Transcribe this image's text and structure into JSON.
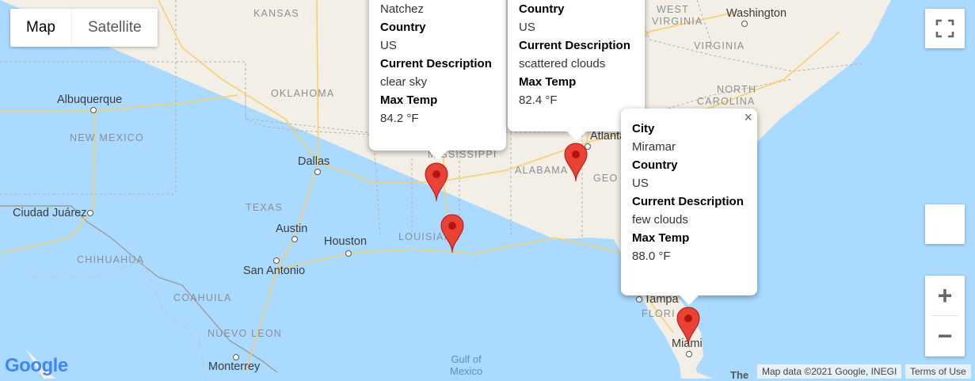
{
  "map": {
    "type_control": {
      "map_label": "Map",
      "satellite_label": "Satellite"
    },
    "state_labels": [
      "KANSAS",
      "OKLAHOMA",
      "NEW MEXICO",
      "TEXAS",
      "LOUISIANA",
      "MISSISSIPPI",
      "ALABAMA",
      "GEO",
      "WEST",
      "VIRGINIA",
      "VIRGINIA",
      "NORTH",
      "CAROLINA",
      "FLORI",
      "CHIHUAHUA",
      "COAHUILA",
      "NUEVO LEON"
    ],
    "city_labels": [
      "Albuquerque",
      "Dallas",
      "Ciudad Juárez",
      "Austin",
      "Houston",
      "San Antonio",
      "Monterrey",
      "Atlanta",
      "Washington",
      "Tampa",
      "Miami",
      "Natchez"
    ],
    "water_label_line1": "Gulf of",
    "water_label_line2": "Mexico",
    "partial_label": "The",
    "google_logo": "Google",
    "attribution": "Map data ©2021 Google, INEGI",
    "terms": "Terms of Use",
    "zoom_in": "+",
    "zoom_out": "−",
    "marker_color": "#ea4335"
  },
  "info_windows": [
    {
      "rows": [
        {
          "k": "",
          "v": "Natchez"
        },
        {
          "k": "Country",
          "v": "US"
        },
        {
          "k": "Current Description",
          "v": "clear sky"
        },
        {
          "k": "Max Temp",
          "v": "84.2 °F"
        }
      ]
    },
    {
      "rows": [
        {
          "k": "Country",
          "v": "US"
        },
        {
          "k": "Current Description",
          "v": "scattered clouds"
        },
        {
          "k": "Max Temp",
          "v": "82.4 °F"
        }
      ]
    },
    {
      "close": "×",
      "rows": [
        {
          "k": "City",
          "v": "Miramar"
        },
        {
          "k": "Country",
          "v": "US"
        },
        {
          "k": "Current Description",
          "v": "few clouds"
        },
        {
          "k": "Max Temp",
          "v": "88.0 °F"
        }
      ]
    }
  ]
}
